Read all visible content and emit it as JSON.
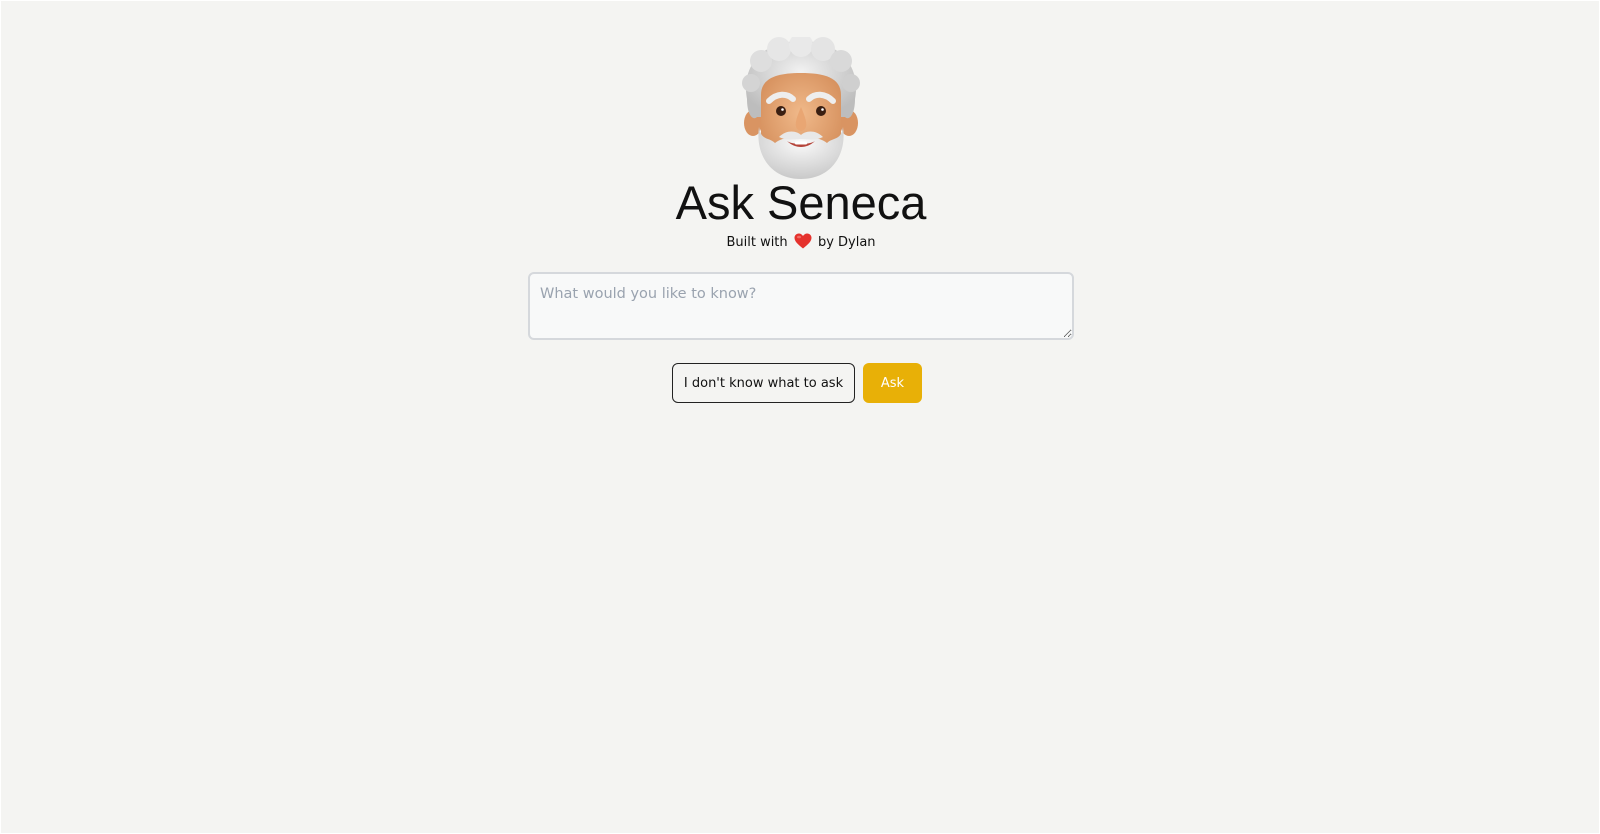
{
  "header": {
    "avatar_icon": "seneca-bust-avatar-icon",
    "title": "Ask Seneca",
    "subtitle_prefix": "Built with",
    "subtitle_icon": "red-heart-icon",
    "subtitle_suffix": "by Dylan"
  },
  "form": {
    "question_placeholder": "What would you like to know?",
    "question_value": "",
    "random_question_label": "I don't know what to ask",
    "ask_label": "Ask"
  },
  "colors": {
    "page_background": "#f4f4f2",
    "accent": "#e8b007",
    "heart": "#e5322d"
  }
}
